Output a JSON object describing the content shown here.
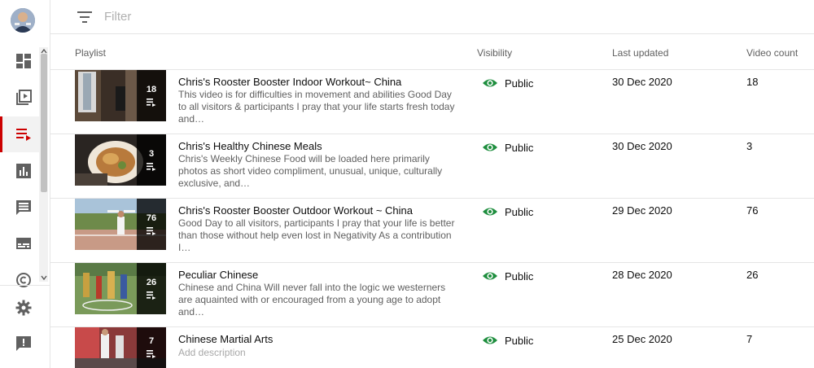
{
  "filter": {
    "placeholder": "Filter"
  },
  "table": {
    "headers": {
      "playlist": "Playlist",
      "visibility": "Visibility",
      "last_updated": "Last updated",
      "video_count": "Video count"
    },
    "rows": [
      {
        "thumb_count": "18",
        "title": "Chris's Rooster Booster Indoor Workout~ China",
        "desc": "This video is for difficulties in movement and abilities Good Day to all visitors & participants I pray that your life starts fresh today and…",
        "visibility": "Public",
        "updated": "30 Dec 2020",
        "count": "18"
      },
      {
        "thumb_count": "3",
        "title": "Chris's Healthy Chinese Meals",
        "desc": "Chris's Weekly Chinese Food will be loaded here primarily photos as short video compliment, unusual, unique, culturally exclusive, and…",
        "visibility": "Public",
        "updated": "30 Dec 2020",
        "count": "3"
      },
      {
        "thumb_count": "76",
        "title": "Chris's Rooster Booster Outdoor Workout ~ China",
        "desc": "Good Day to all visitors, participants I pray that your life is better than those without help even lost in Negativity As a contribution I…",
        "visibility": "Public",
        "updated": "29 Dec 2020",
        "count": "76"
      },
      {
        "thumb_count": "26",
        "title": "Peculiar Chinese",
        "desc": "Chinese and China Will never fall into the logic we westerners are aquainted with or encouraged from a young age to adopt and…",
        "visibility": "Public",
        "updated": "28 Dec 2020",
        "count": "26"
      },
      {
        "thumb_count": "7",
        "title": "Chinese Martial Arts",
        "desc": "Add description",
        "visibility": "Public",
        "updated": "25 Dec 2020",
        "count": "7"
      }
    ]
  },
  "colors": {
    "accent": "#cc0000",
    "public_icon": "#1e8e3e"
  },
  "sidebar": {
    "items": [
      {
        "icon": "dashboard-icon"
      },
      {
        "icon": "content-icon"
      },
      {
        "icon": "playlists-icon",
        "active": true
      },
      {
        "icon": "analytics-icon"
      },
      {
        "icon": "comments-icon"
      },
      {
        "icon": "subtitles-icon"
      },
      {
        "icon": "copyright-icon"
      },
      {
        "icon": "settings-icon"
      },
      {
        "icon": "feedback-icon"
      }
    ]
  }
}
